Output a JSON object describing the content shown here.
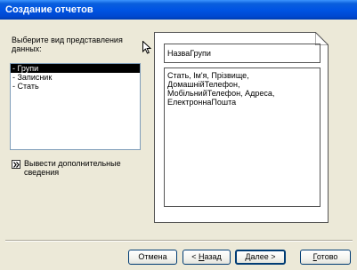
{
  "window": {
    "title": "Создание отчетов"
  },
  "left_panel": {
    "prompt": "Выберите вид представления данных:",
    "list_items": [
      {
        "label": "- Групи",
        "selected": true
      },
      {
        "label": "- Записник",
        "selected": false
      },
      {
        "label": "- Стать",
        "selected": false
      }
    ],
    "more_details": {
      "icon": "expand-icon",
      "label": "Вывести дополнительные сведения"
    }
  },
  "preview": {
    "group_field": "НазваГрупи",
    "detail_fields": "Стать, Ім'я, Прізвище,\nДомашнійТелефон,\nМобільнийТелефон, Адреса,\nЕлектроннаПошта"
  },
  "buttons": {
    "cancel": "Отмена",
    "back_prefix": "< ",
    "back_key": "Н",
    "back_rest": "азад",
    "next_key": "Д",
    "next_rest": "алее >",
    "finish_key": "Г",
    "finish_rest": "отово"
  },
  "colors": {
    "title_bar": "#0054e3",
    "dialog_bg": "#ece9d8",
    "selection_bg": "#000000",
    "button_border": "#003c74"
  }
}
